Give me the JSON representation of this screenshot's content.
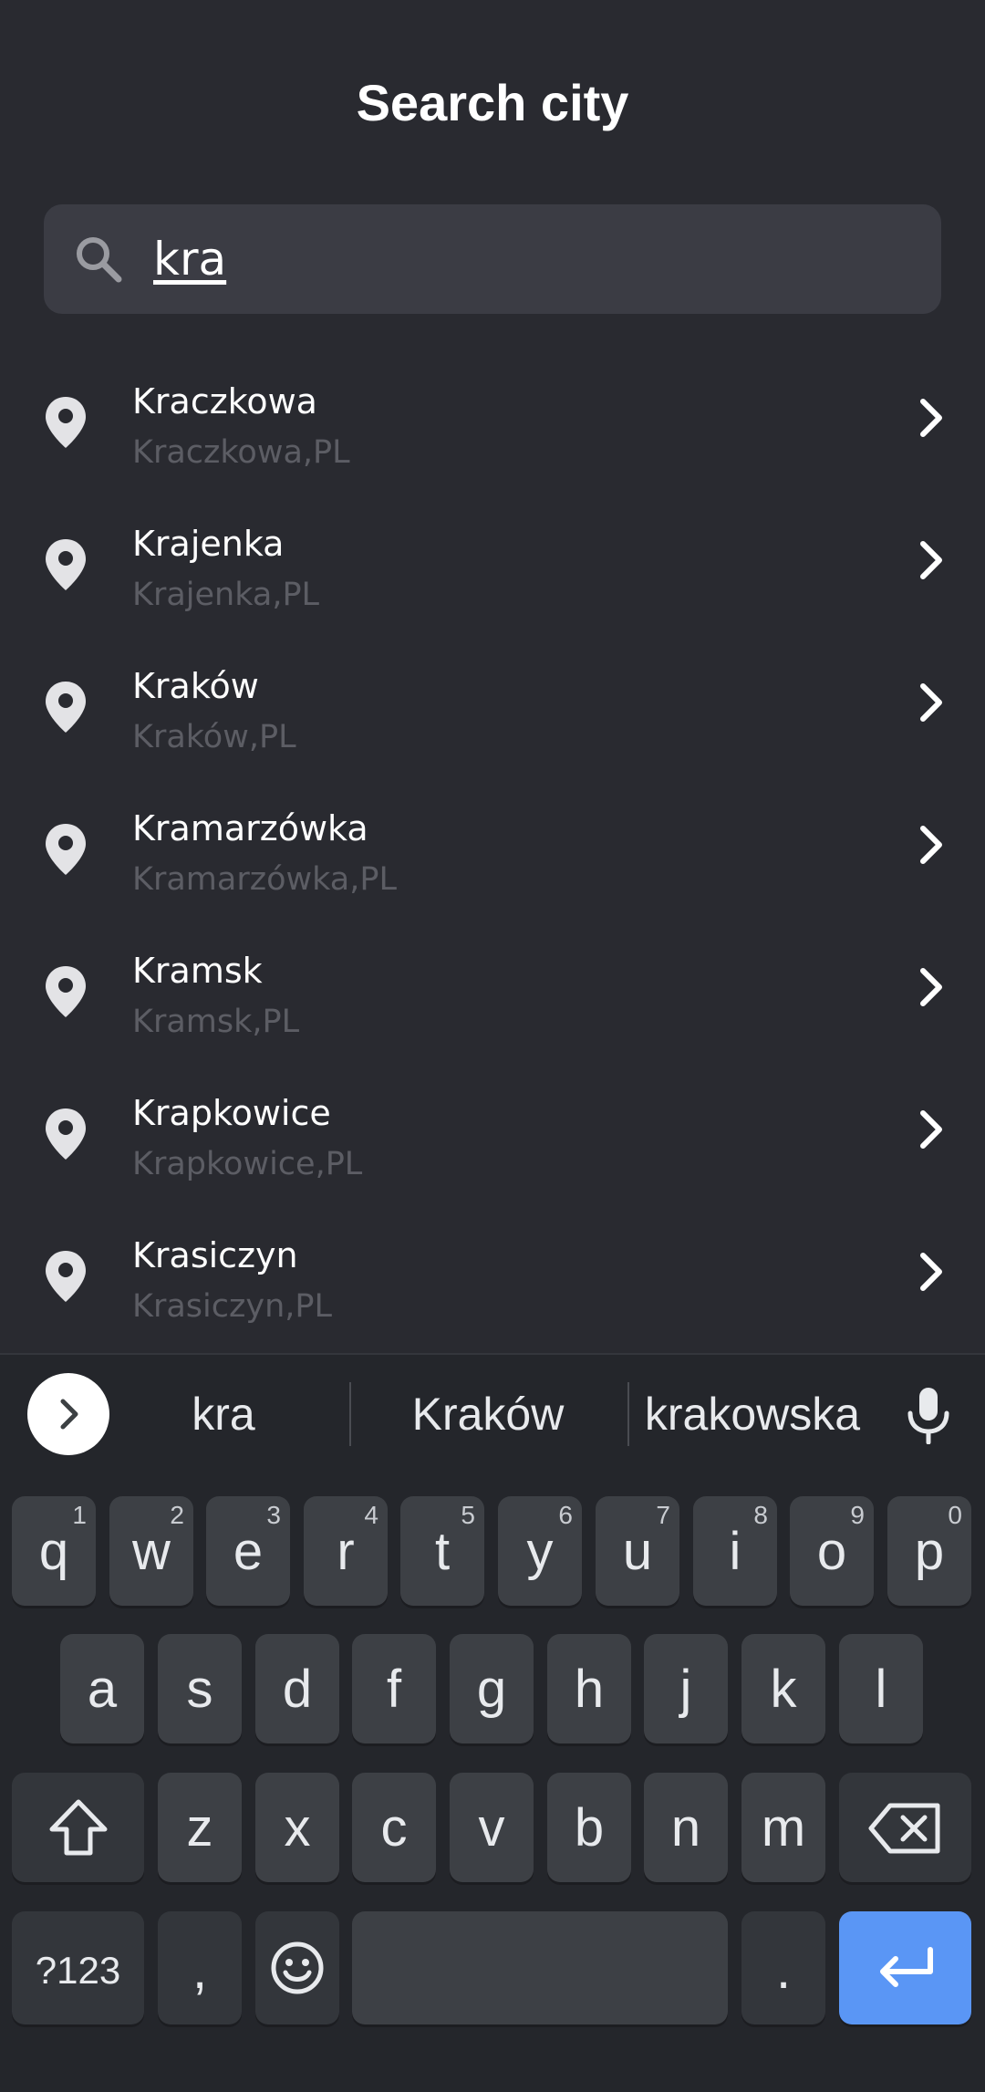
{
  "header": {
    "title": "Search city"
  },
  "search": {
    "value": "kra"
  },
  "results": [
    {
      "name": "Kraczkowa",
      "sub": "Kraczkowa,PL"
    },
    {
      "name": "Krajenka",
      "sub": "Krajenka,PL"
    },
    {
      "name": "Kraków",
      "sub": "Kraków,PL"
    },
    {
      "name": "Kramarzówka",
      "sub": "Kramarzówka,PL"
    },
    {
      "name": "Kramsk",
      "sub": "Kramsk,PL"
    },
    {
      "name": "Krapkowice",
      "sub": "Krapkowice,PL"
    },
    {
      "name": "Krasiczyn",
      "sub": "Krasiczyn,PL"
    }
  ],
  "keyboard": {
    "suggestions": [
      "kra",
      "Kraków",
      "krakowska"
    ],
    "row1": [
      {
        "k": "q",
        "h": "1"
      },
      {
        "k": "w",
        "h": "2"
      },
      {
        "k": "e",
        "h": "3"
      },
      {
        "k": "r",
        "h": "4"
      },
      {
        "k": "t",
        "h": "5"
      },
      {
        "k": "y",
        "h": "6"
      },
      {
        "k": "u",
        "h": "7"
      },
      {
        "k": "i",
        "h": "8"
      },
      {
        "k": "o",
        "h": "9"
      },
      {
        "k": "p",
        "h": "0"
      }
    ],
    "row2": [
      "a",
      "s",
      "d",
      "f",
      "g",
      "h",
      "j",
      "k",
      "l"
    ],
    "row3": [
      "z",
      "x",
      "c",
      "v",
      "b",
      "n",
      "m"
    ],
    "symbols_label": "?123",
    "comma_label": ",",
    "period_label": "."
  },
  "colors": {
    "background": "#292a30",
    "search_bg": "#3b3c44",
    "subtitle": "#5c5d64",
    "enter_key": "#5a96f5"
  },
  "icons": {
    "search": "search-icon",
    "pin": "location-pin-icon",
    "chevron": "chevron-right-icon",
    "mic": "mic-icon",
    "shift": "shift-icon",
    "backspace": "backspace-icon",
    "emoji": "emoji-icon",
    "enter": "enter-icon"
  }
}
